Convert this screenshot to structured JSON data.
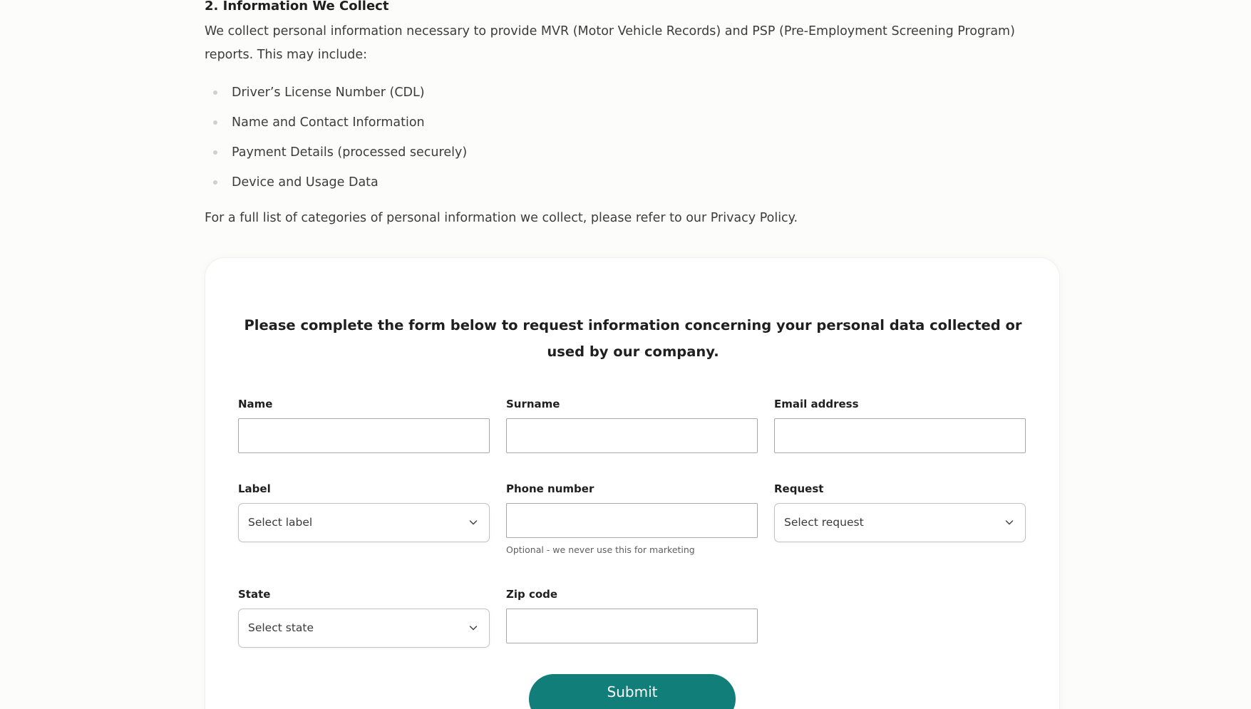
{
  "section": {
    "heading": "2. Information We Collect",
    "intro": "We collect personal information necessary to provide MVR (Motor Vehicle Records) and PSP (Pre-Employment Screening Program) reports. This may include:",
    "bullets": [
      "Driver’s License Number (CDL)",
      "Name and Contact Information",
      "Payment Details (processed securely)",
      "Device and Usage Data"
    ],
    "full_list": "For a full list of categories of personal information we collect, please refer to our Privacy Policy."
  },
  "form": {
    "title": "Please complete the form below to request information concerning your personal data collected or used by our company.",
    "name_label": "Name",
    "surname_label": "Surname",
    "email_label": "Email address",
    "label_label": "Label",
    "label_value": "Select label",
    "phone_label": "Phone number",
    "phone_hint": "Optional - we never use this for marketing",
    "request_label": "Request",
    "request_value": "Select request",
    "state_label": "State",
    "state_value": "Select state",
    "zip_label": "Zip code",
    "submit_label": "Submit",
    "icons": {
      "dropdown": "chevron-down-icon"
    },
    "colors": {
      "submit_background": "#127e7a",
      "submit_text": "#ffffff"
    }
  }
}
